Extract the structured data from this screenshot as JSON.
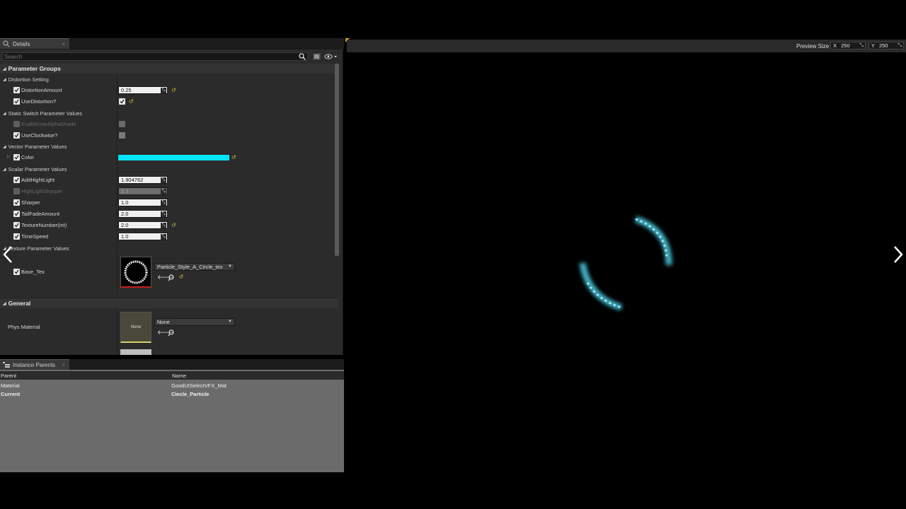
{
  "details": {
    "tab_label": "Details",
    "tab_close": "×",
    "search_placeholder": "Search",
    "parameter_groups_title": "Parameter Groups",
    "groups": {
      "distortion": "Distortion Setting",
      "static_switch": "Static Switch Parameter Values",
      "vector": "Vector Parameter Values",
      "scalar": "Scalar Parameter Values",
      "texture": "Texture Parameter Values"
    },
    "params": {
      "distortion_amount": {
        "label": "DistortionAmount",
        "value": "0.25"
      },
      "use_distortion": {
        "label": "UseDistortion?"
      },
      "enable_use_alpha_shade": {
        "label": "EnableUseAlphaShade"
      },
      "use_clockwise": {
        "label": "UseClockwise?"
      },
      "color": {
        "label": "Color",
        "value_hex": "#00e5ff"
      },
      "add_highlight": {
        "label": "AddHightLight",
        "value": "1.904762"
      },
      "highlight_sharper": {
        "label": "HighLightSharper",
        "value": "2.3"
      },
      "sharper": {
        "label": "Sharper",
        "value": "1.0"
      },
      "tail_fade_amount": {
        "label": "TailFadeAmount",
        "value": "2.0"
      },
      "texture_number": {
        "label": "TextureNumber(int)",
        "value": "2.0"
      },
      "time_speed": {
        "label": "TimeSpeed",
        "value": "1.0"
      },
      "base_tex": {
        "label": "Base_Tex",
        "asset": "Particle_Style_A_Circle_tex"
      }
    },
    "general_title": "General",
    "phys_material": {
      "label": "Phys Material",
      "thumb_text": "None",
      "value": "None"
    }
  },
  "instance_parents": {
    "tab_label": "Instance Parents",
    "tab_close": "×",
    "columns": [
      "Parent",
      "Name"
    ],
    "rows": [
      {
        "parent": "Material",
        "name": "GoodUISelectVFX_Mat"
      },
      {
        "parent": "Current",
        "name": "Ciecle_Particle"
      }
    ]
  },
  "viewport": {
    "preview_size_label": "Preview Size",
    "x_label": "X",
    "x_value": "250",
    "y_label": "Y",
    "y_value": "250"
  },
  "colors": {
    "accent_cyan": "#00e5ff",
    "reset_yellow": "#d8c241"
  }
}
